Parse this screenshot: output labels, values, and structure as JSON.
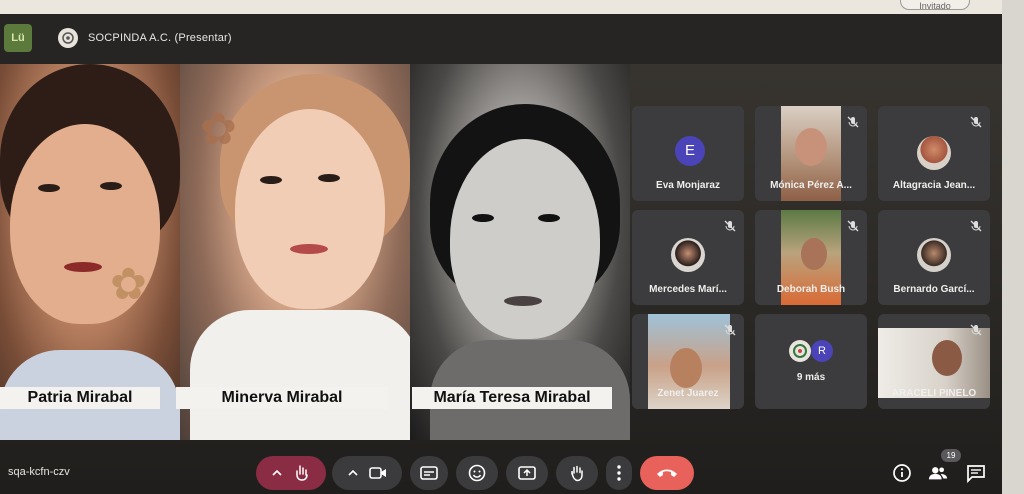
{
  "browser": {
    "invite_label": "Invitado"
  },
  "header": {
    "app_logo_text": "Lü",
    "presenter_avatar_letter": "☹",
    "title": "SOCPINDA A.C. (Presentar)"
  },
  "presentation": {
    "names": [
      "Patria Mirabal",
      "Minerva Mirabal",
      "María Teresa Mirabal"
    ]
  },
  "participants": [
    {
      "name": "Eva Monjaraz",
      "type": "letter",
      "letter": "E",
      "muted": false
    },
    {
      "name": "Mónica Pérez A...",
      "type": "video",
      "muted": true
    },
    {
      "name": "Altagracia Jean...",
      "type": "photo",
      "muted": true
    },
    {
      "name": "Mercedes Marí...",
      "type": "photo",
      "muted": true
    },
    {
      "name": "Deborah Bush",
      "type": "video",
      "muted": true
    },
    {
      "name": "Bernardo Garcí...",
      "type": "photo",
      "muted": true
    },
    {
      "name": "Zenet Juarez",
      "type": "video",
      "muted": true
    },
    {
      "name": "9 más",
      "type": "more",
      "letter": "R"
    },
    {
      "name": "ARACELI PINELO",
      "type": "video",
      "muted": true
    }
  ],
  "footer": {
    "meeting_code": "sqa-kcfn-czv",
    "participant_count": "19"
  },
  "colors": {
    "end_call": "#e8625b",
    "hand_raise_active": "#8a2d44",
    "control_bg": "#3b3b3d",
    "letter_avatar": "#4a44b8"
  }
}
